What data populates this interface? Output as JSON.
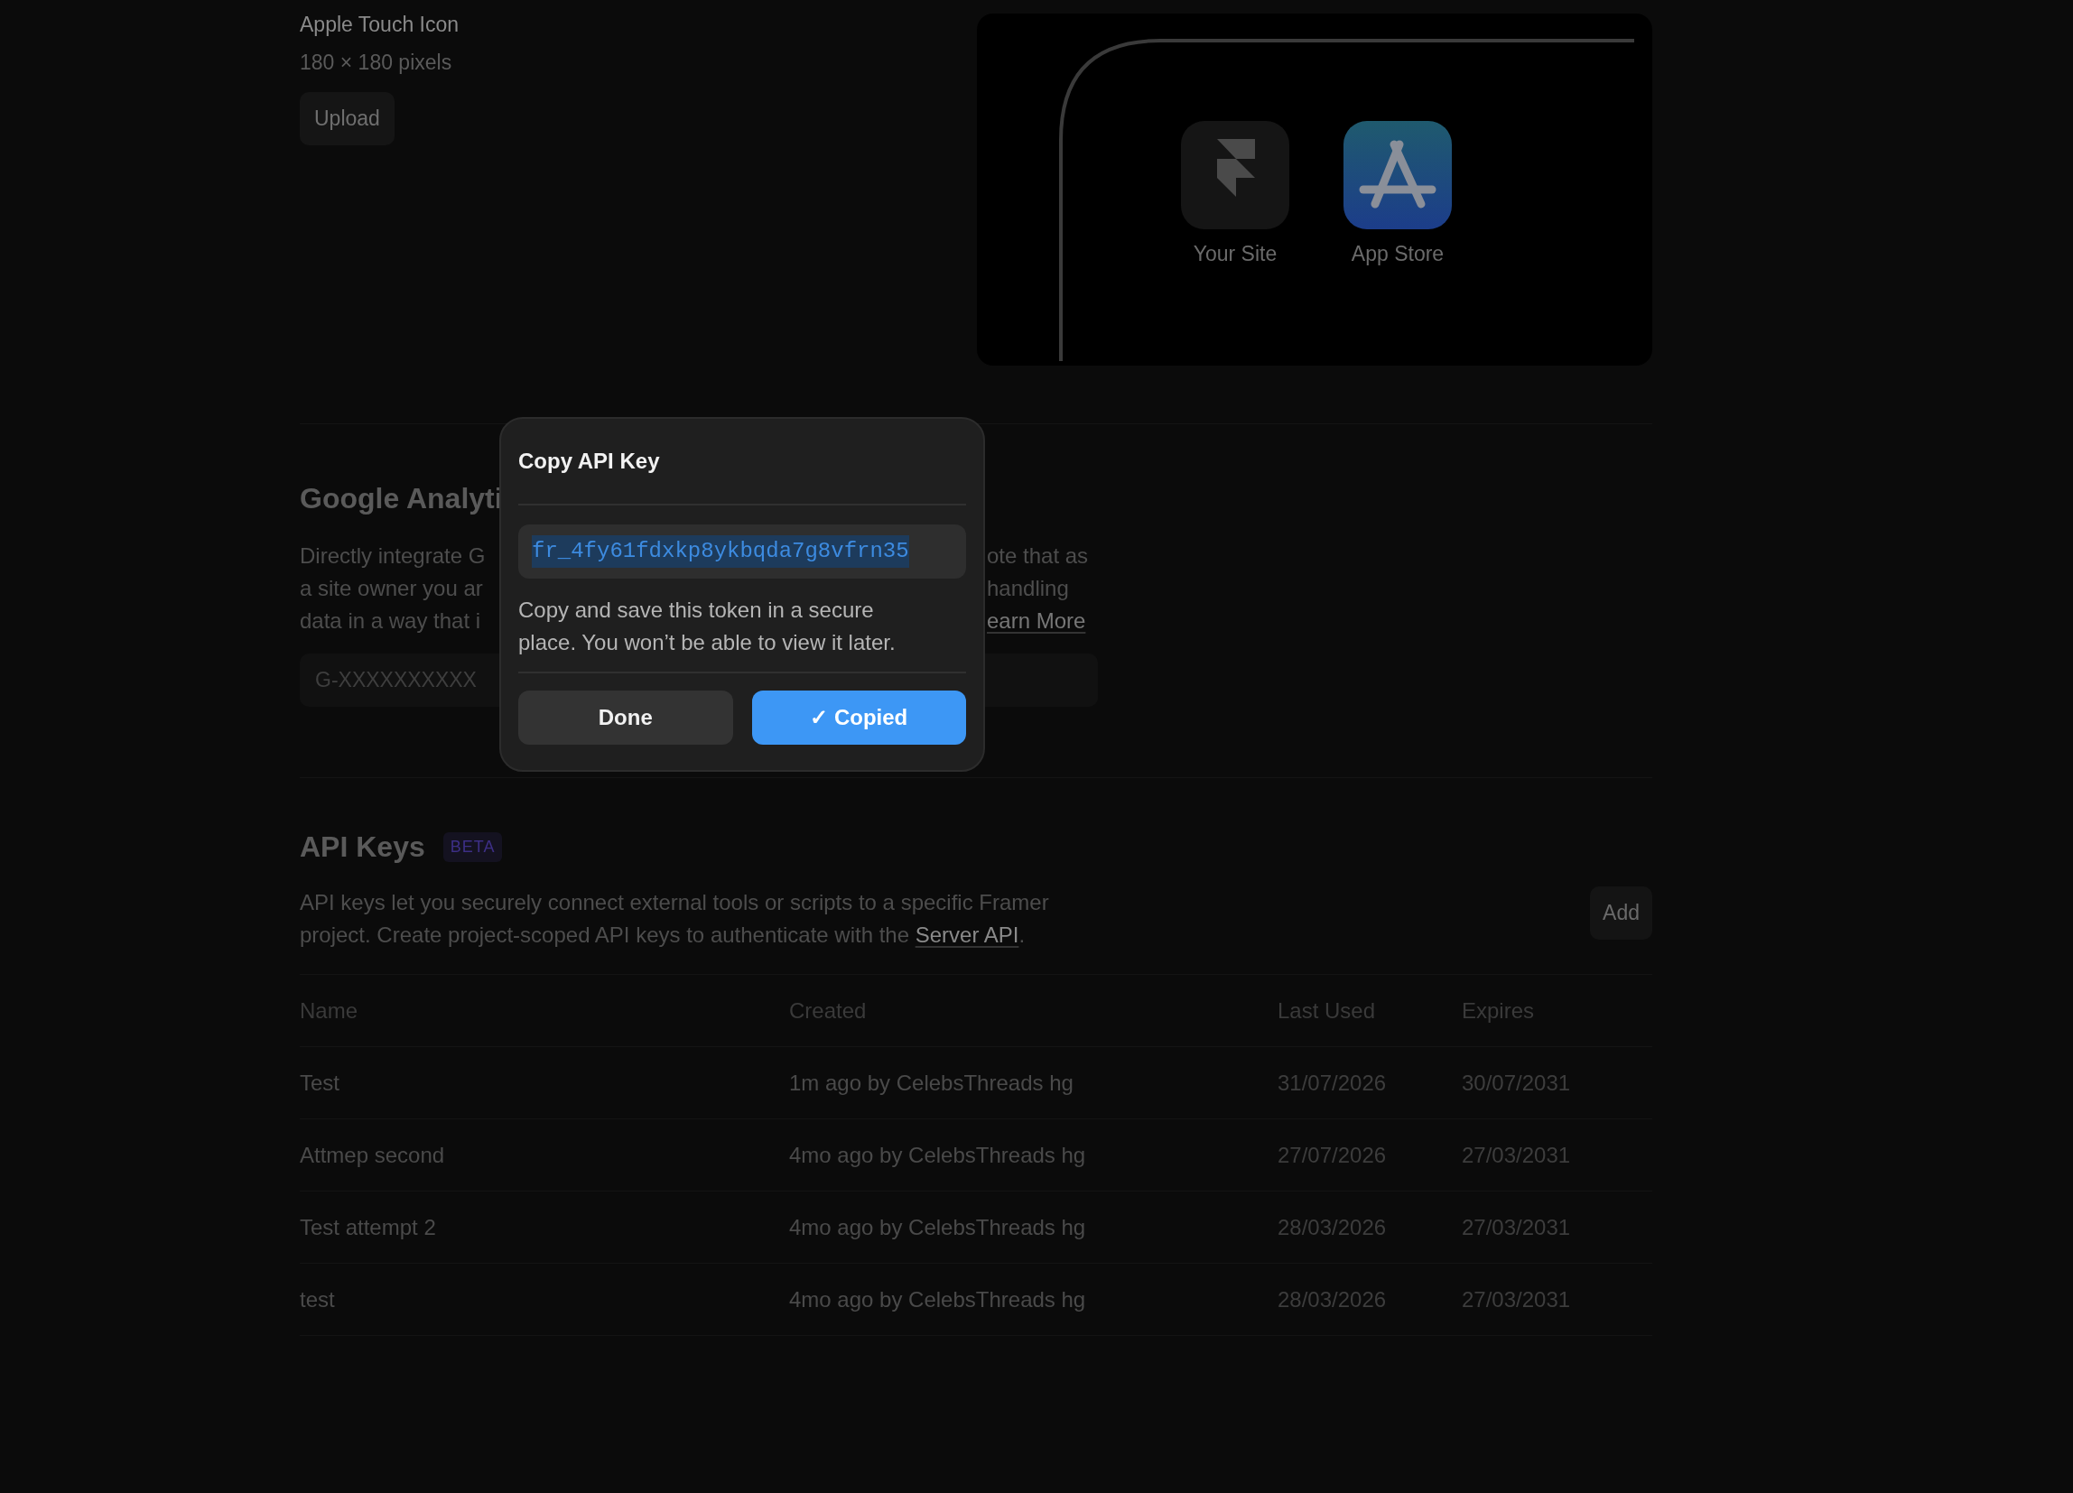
{
  "apple_touch_icon": {
    "title": "Apple Touch Icon",
    "subtitle": "180 × 180 pixels",
    "upload_button": "Upload"
  },
  "preview": {
    "apps": [
      {
        "label": "Your Site",
        "kind": "site"
      },
      {
        "label": "App Store",
        "kind": "store"
      }
    ]
  },
  "google_analytics": {
    "title": "Google Analyti",
    "lines": [
      {
        "left": "Directly integrate G",
        "right": "ote that as",
        "right_is_link": false
      },
      {
        "left": "a site owner you ar",
        "right": "handling",
        "right_is_link": false
      },
      {
        "left": "data in a way that i",
        "right": "earn More",
        "right_is_link": true
      }
    ],
    "field": {
      "placeholder": "G-XXXXXXXXXX"
    }
  },
  "api_keys": {
    "title": "API Keys",
    "badge": "BETA",
    "description": "API keys let you securely connect external tools or scripts to a specific Framer project. Create project-scoped API keys to authenticate with the",
    "link": "Server API",
    "description_end": ".",
    "add_button": "Add",
    "table": {
      "columns": [
        "Name",
        "Created",
        "Last Used",
        "Expires"
      ],
      "rows": [
        [
          "Test",
          "1m ago by CelebsThreads hg",
          "31/07/2026",
          "30/07/2031"
        ],
        [
          "Attmep second",
          "4mo ago by CelebsThreads hg",
          "27/07/2026",
          "27/03/2031"
        ],
        [
          "Test attempt 2",
          "4mo ago by CelebsThreads hg",
          "28/03/2026",
          "27/03/2031"
        ],
        [
          "test",
          "4mo ago by CelebsThreads hg",
          "28/03/2026",
          "27/03/2031"
        ]
      ]
    }
  },
  "dialog": {
    "title": "Copy API Key",
    "api_key": "fr_4fy61fdxkp8ykbqda7g8vfrn35",
    "key_selected": true,
    "message": "Copy and save this token in a secure place. You won’t be able to view it later.",
    "buttons": [
      {
        "label": "Done",
        "kind": "secondary"
      },
      {
        "label": "✓ Copied",
        "kind": "primary"
      }
    ]
  }
}
